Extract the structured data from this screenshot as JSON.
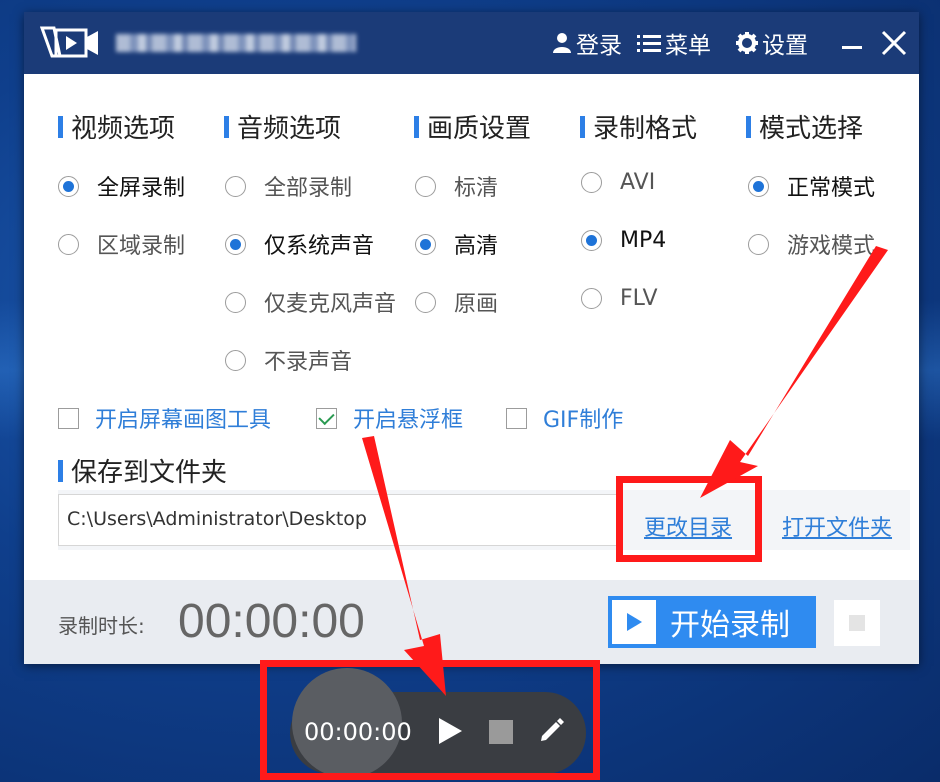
{
  "titlebar": {
    "login": "登录",
    "menu": "菜单",
    "settings": "设置"
  },
  "sections": {
    "video": {
      "title": "视频选项",
      "options": [
        {
          "label": "全屏录制",
          "selected": true
        },
        {
          "label": "区域录制",
          "selected": false
        }
      ]
    },
    "audio": {
      "title": "音频选项",
      "options": [
        {
          "label": "全部录制",
          "selected": false
        },
        {
          "label": "仅系统声音",
          "selected": true
        },
        {
          "label": "仅麦克风声音",
          "selected": false
        },
        {
          "label": "不录声音",
          "selected": false
        }
      ]
    },
    "quality": {
      "title": "画质设置",
      "options": [
        {
          "label": "标清",
          "selected": false
        },
        {
          "label": "高清",
          "selected": true
        },
        {
          "label": "原画",
          "selected": false
        }
      ]
    },
    "format": {
      "title": "录制格式",
      "options": [
        {
          "label": "AVI",
          "selected": false
        },
        {
          "label": "MP4",
          "selected": true
        },
        {
          "label": "FLV",
          "selected": false
        }
      ]
    },
    "mode": {
      "title": "模式选择",
      "options": [
        {
          "label": "正常模式",
          "selected": true
        },
        {
          "label": "游戏模式",
          "selected": false
        }
      ]
    }
  },
  "checkboxes": [
    {
      "label": "开启屏幕画图工具",
      "checked": false
    },
    {
      "label": "开启悬浮框",
      "checked": true
    },
    {
      "label": "GIF制作",
      "checked": false
    }
  ],
  "save": {
    "title": "保存到文件夹",
    "path": "C:\\Users\\Administrator\\Desktop",
    "change_dir": "更改目录",
    "open_folder": "打开文件夹"
  },
  "bottom": {
    "duration_label": "录制时长:",
    "duration_value": "00:00:00",
    "start_label": "开始录制"
  },
  "floating": {
    "time": "00:00:00"
  },
  "colors": {
    "titlebar": "#1b3b78",
    "accent": "#2f8bf0",
    "link": "#2f7ed8",
    "annotation": "#ff1a1a"
  }
}
